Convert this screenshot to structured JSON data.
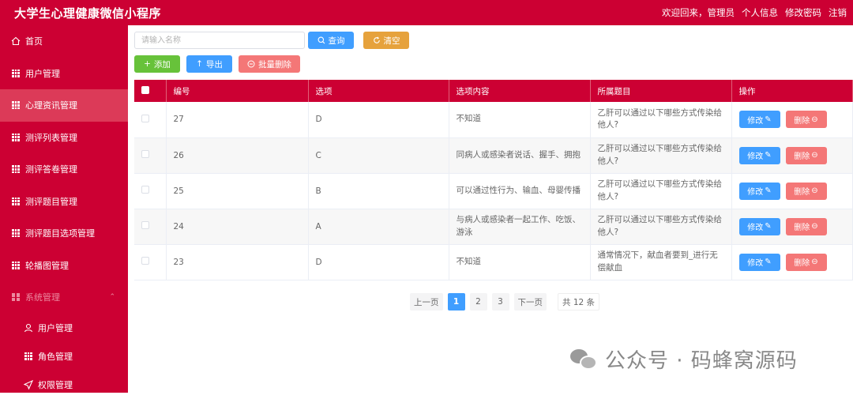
{
  "header": {
    "title": "大学生心理健康微信小程序",
    "welcome": "欢迎回来，管理员",
    "links": [
      "个人信息",
      "修改密码",
      "注销"
    ]
  },
  "sidebar": {
    "items": [
      {
        "label": "首页",
        "icon": "home-icon"
      },
      {
        "label": "用户管理",
        "icon": "grid-icon"
      },
      {
        "label": "心理资讯管理",
        "icon": "grid-icon",
        "active": true
      },
      {
        "label": "测评列表管理",
        "icon": "grid-icon"
      },
      {
        "label": "测评答卷管理",
        "icon": "grid-icon"
      },
      {
        "label": "测评题目管理",
        "icon": "grid-icon"
      },
      {
        "label": "测评题目选项管理",
        "icon": "grid-icon"
      },
      {
        "label": "轮播图管理",
        "icon": "grid-icon"
      },
      {
        "label": "系统管理",
        "icon": "apps-icon",
        "expanded": true
      }
    ],
    "sub_items": [
      {
        "label": "用户管理",
        "icon": "user-icon"
      },
      {
        "label": "角色管理",
        "icon": "grid-icon"
      },
      {
        "label": "权限管理",
        "icon": "send-icon"
      }
    ]
  },
  "toolbar": {
    "search_placeholder": "请输入名称",
    "query": "查询",
    "clear": "清空",
    "add": "添加",
    "export": "导出",
    "batch_delete": "批量删除"
  },
  "table": {
    "headers": [
      "编号",
      "选项",
      "选项内容",
      "所属题目",
      "操作"
    ],
    "rows": [
      {
        "id": "27",
        "option": "D",
        "content": "不知道",
        "topic": "乙肝可以通过以下哪些方式传染给他人?"
      },
      {
        "id": "26",
        "option": "C",
        "content": "同病人或感染者说话、握手、拥抱",
        "topic": "乙肝可以通过以下哪些方式传染给他人?"
      },
      {
        "id": "25",
        "option": "B",
        "content": "可以通过性行为、输血、母婴传播",
        "topic": "乙肝可以通过以下哪些方式传染给他人?"
      },
      {
        "id": "24",
        "option": "A",
        "content": "与病人或感染者一起工作、吃饭、游泳",
        "topic": "乙肝可以通过以下哪些方式传染给他人?"
      },
      {
        "id": "23",
        "option": "D",
        "content": "不知道",
        "topic": "通常情况下，献血者要到_进行无偿献血"
      }
    ],
    "edit_label": "修改",
    "delete_label": "删除"
  },
  "pagination": {
    "prev": "上一页",
    "pages": [
      "1",
      "2",
      "3"
    ],
    "current": "1",
    "next": "下一页",
    "total": "共 12 条"
  },
  "watermark": {
    "text": "公众号 · 码蜂窝源码"
  }
}
